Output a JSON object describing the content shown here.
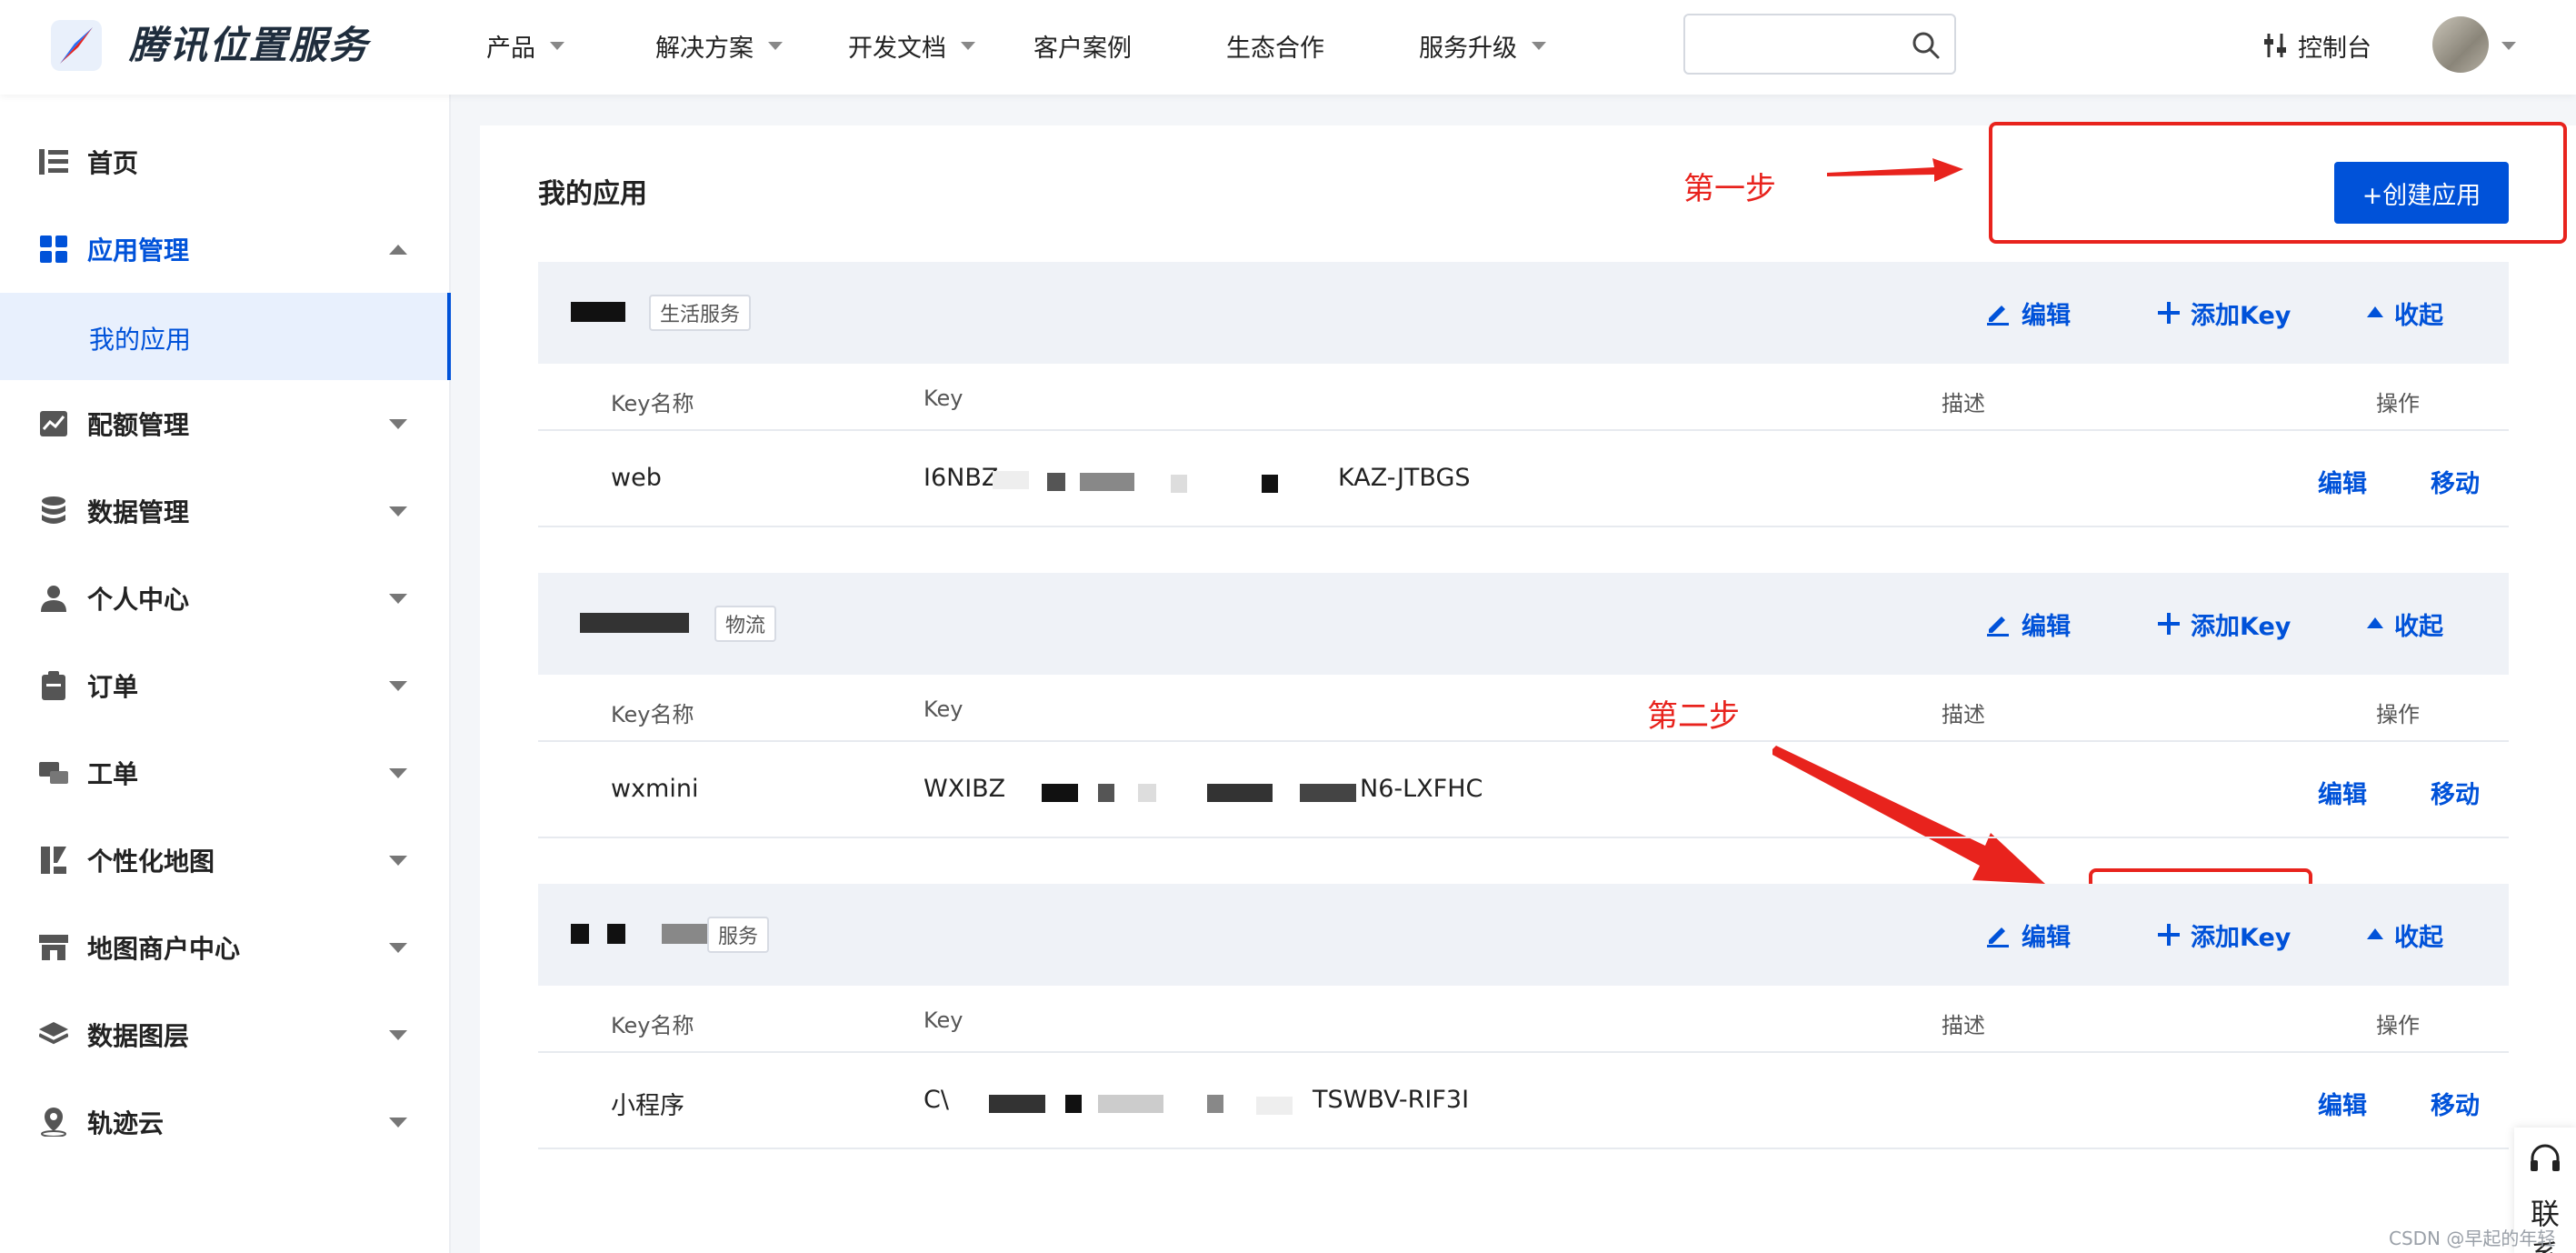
{
  "brand": {
    "name": "腾讯位置服务"
  },
  "nav": [
    {
      "label": "产品",
      "dropdown": true
    },
    {
      "label": "解决方案",
      "dropdown": true
    },
    {
      "label": "开发文档",
      "dropdown": true
    },
    {
      "label": "客户案例",
      "dropdown": false
    },
    {
      "label": "生态合作",
      "dropdown": false
    },
    {
      "label": "服务升级",
      "dropdown": true
    }
  ],
  "search": {
    "placeholder": ""
  },
  "console": {
    "label": "控制台"
  },
  "sidebar": {
    "items": [
      {
        "label": "首页",
        "icon": "list-icon"
      },
      {
        "label": "应用管理",
        "icon": "grid-icon",
        "expanded": true
      },
      {
        "label": "配额管理",
        "icon": "chart-icon"
      },
      {
        "label": "数据管理",
        "icon": "database-icon"
      },
      {
        "label": "个人中心",
        "icon": "user-icon"
      },
      {
        "label": "订单",
        "icon": "clipboard-icon"
      },
      {
        "label": "工单",
        "icon": "ticket-icon"
      },
      {
        "label": "个性化地图",
        "icon": "map-style-icon"
      },
      {
        "label": "地图商户中心",
        "icon": "store-icon"
      },
      {
        "label": "数据图层",
        "icon": "layers-icon"
      },
      {
        "label": "轨迹云",
        "icon": "location-icon"
      }
    ],
    "active_sub": "我的应用"
  },
  "main": {
    "title": "我的应用",
    "create_button": "+创建应用",
    "annotations": {
      "step1": "第一步",
      "step2": "第二步"
    },
    "columns": {
      "key_name": "Key名称",
      "key": "Key",
      "desc": "描述",
      "ops": "操作"
    },
    "actions": {
      "edit": "编辑",
      "add_key": "添加Key",
      "collapse": "收起",
      "row_edit": "编辑",
      "row_move": "移动"
    },
    "apps": [
      {
        "tag": "生活服务",
        "row": {
          "key_name": "web",
          "key_prefix": "I6NBZ",
          "key_suffix": "KAZ-JTBGS"
        }
      },
      {
        "tag": "物流",
        "row": {
          "key_name": "wxmini",
          "key_prefix": "WXIBZ",
          "key_suffix": "N6-LXFHC"
        }
      },
      {
        "tag": "服务",
        "row": {
          "key_name": "小程序",
          "key_prefix": "C\\",
          "key_suffix": "TSWBV-RIF3I"
        }
      }
    ]
  },
  "help": {
    "label": "联系"
  },
  "watermark": "CSDN @早起的年轻"
}
